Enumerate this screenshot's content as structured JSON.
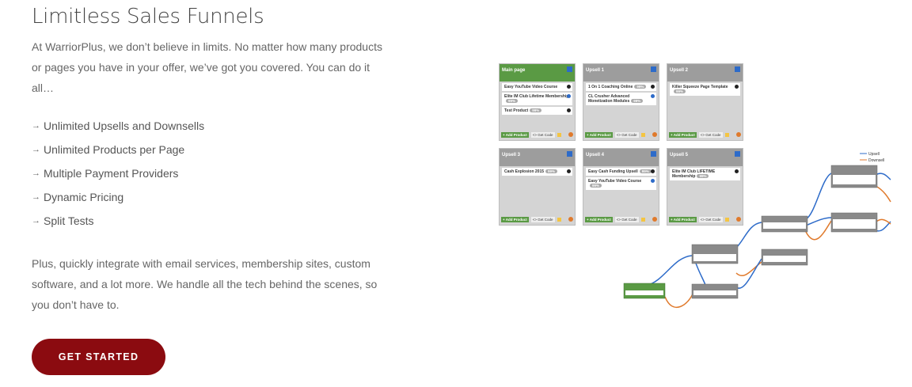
{
  "title": "Limitless Sales Funnels",
  "intro": "At WarriorPlus, we don’t believe in limits. No matter how many products or pages you have in your offer, we’ve got you covered. You can do it all…",
  "features": [
    {
      "arrow": "→",
      "text": "Unlimited Upsells and Downsells"
    },
    {
      "arrow": "→",
      "text": "Unlimited Products per Page"
    },
    {
      "arrow": "→",
      "text": "Multiple Payment Providers"
    },
    {
      "arrow": "→",
      "text": "Dynamic Pricing"
    },
    {
      "arrow": "→",
      "text": "Split Tests"
    }
  ],
  "outro": "Plus, quickly integrate with email services, membership sites, custom software, and a lot more. We handle all the tech behind the scenes, so you don’t have to.",
  "cta_label": "GET STARTED",
  "colors": {
    "cta": "#8b0b10",
    "upsell": "#2d6bc9",
    "downsell": "#e07a2c",
    "main_page": "#5a9a44"
  },
  "funnel_cards": [
    {
      "name": "Main page",
      "green": true,
      "rows": [
        {
          "text": "Easy YouTube Video Course",
          "pill": ""
        },
        {
          "text": "Elite IM Club Lifetime Membership",
          "pill": "99%"
        },
        {
          "text": "Test Product",
          "pill": "99%"
        }
      ]
    },
    {
      "name": "Upsell 1",
      "green": false,
      "rows": [
        {
          "text": "1 On 1 Coaching Online",
          "pill": "99%"
        },
        {
          "text": "CL Crusher Advanced Monetization Modules",
          "pill": "99%"
        }
      ]
    },
    {
      "name": "Upsell 2",
      "green": false,
      "rows": [
        {
          "text": "Killer Squeeze Page Template",
          "pill": "99%"
        }
      ]
    },
    {
      "name": "Upsell 3",
      "green": false,
      "rows": [
        {
          "text": "Cash Explosion 2015",
          "pill": "99%"
        }
      ]
    },
    {
      "name": "Upsell 4",
      "green": false,
      "rows": [
        {
          "text": "Easy Cash Funding Upsell",
          "pill": "99%"
        },
        {
          "text": "Easy YouTube Video Course",
          "pill": "99%"
        }
      ]
    },
    {
      "name": "Upsell 5",
      "green": false,
      "rows": [
        {
          "text": "Elite IM Club LIFETIME Membership",
          "pill": "99%"
        }
      ]
    }
  ],
  "card_footer": {
    "add": "+ Add Product",
    "code": "<> Get Code"
  },
  "legend": {
    "upsell": "Upsell",
    "downsell": "Downsell"
  }
}
